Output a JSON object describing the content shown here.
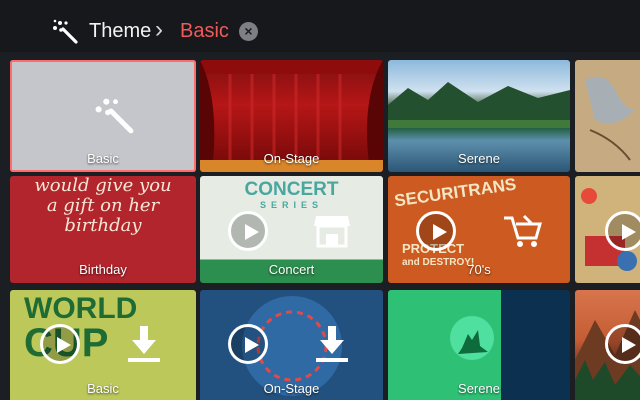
{
  "header": {
    "title": "Theme",
    "separator": "›",
    "current": "Basic",
    "close_glyph": "×"
  },
  "tiles": [
    {
      "label": "Basic",
      "bg": "#c4c6cb",
      "selected": true,
      "art": "magic-wand-icon"
    },
    {
      "label": "On-Stage",
      "bg": "#b61616"
    },
    {
      "label": "Serene",
      "bg": "#1e5c3b"
    },
    {
      "label": "",
      "bg": "#c6aa82"
    },
    {
      "label": "Birthday",
      "bg": "#b3252d",
      "art_text": [
        "would give you",
        "a gift on her",
        "birthday"
      ]
    },
    {
      "label": "Concert",
      "bg": "#e6ebe3",
      "art_text": [
        "CONCERT",
        "SERIES"
      ],
      "overlay": "shop-icon"
    },
    {
      "label": "70's",
      "bg": "#cd5a20",
      "art_text": [
        "SECURITRANS",
        "PROTECT",
        "and DESTROY!"
      ],
      "overlay": "cart-tool-icon"
    },
    {
      "label": "",
      "bg": "#cfb37b"
    },
    {
      "label": "Basic",
      "bg": "#bcc85a",
      "art_text": [
        "WORLD",
        "CUP"
      ],
      "overlay": "download-icon"
    },
    {
      "label": "On-Stage",
      "bg": "#23517f",
      "overlay": "download-icon"
    },
    {
      "label": "Serene",
      "bg": "#2ec175",
      "art": "wolf-moon-icon"
    },
    {
      "label": "",
      "bg": "#c55c34"
    }
  ],
  "colors": {
    "accent": "#f05a5a",
    "selection_outline": "#ff6a6a",
    "header_bg": "#16181c"
  }
}
